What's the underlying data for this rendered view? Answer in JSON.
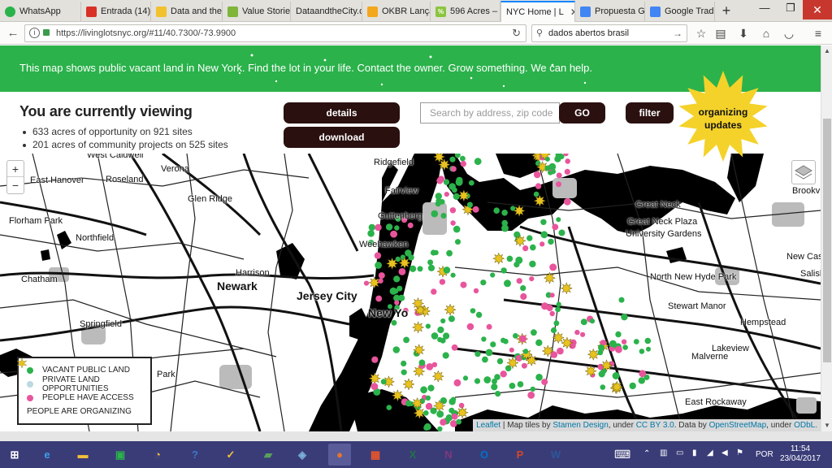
{
  "browser": {
    "tabs": [
      {
        "label": "WhatsApp",
        "color": "#2ab34b"
      },
      {
        "label": "Entrada (14)",
        "color": "#d93025"
      },
      {
        "label": "Data and the",
        "color": "#f2c12e"
      },
      {
        "label": "Value Stories",
        "color": "#7fb539"
      },
      {
        "label": "DataandtheCity.c",
        "color": "#cfcfcf"
      },
      {
        "label": "OKBR Lançar",
        "color": "#f2a71c"
      },
      {
        "label": "596 Acres –",
        "color": "#8bc53f"
      },
      {
        "label": "NYC Home | L",
        "color": "#2bb24b",
        "active": true
      },
      {
        "label": "Propuesta G",
        "color": "#4285f4"
      },
      {
        "label": "Google Trad",
        "color": "#4285f4"
      }
    ],
    "url": "https://livinglotsnyc.org/#11/40.7300/-73.9900",
    "search_value": "dados abertos brasil",
    "window_controls": {
      "minimize": "—",
      "restore": "❐",
      "close": "✕"
    }
  },
  "banner": {
    "text": "This map shows public vacant land in New York. Find the lot in your life. Contact the owner. Grow something. We can help."
  },
  "header": {
    "title": "You are currently viewing",
    "stats": [
      "633 acres of opportunity on 921 sites",
      "201 acres of community projects on 525 sites"
    ],
    "details_label": "details",
    "download_label": "download",
    "search_placeholder": "Search by address, zip code",
    "go_label": "GO",
    "filter_label": "filter",
    "organizing_line1": "organizing",
    "organizing_line2": "updates"
  },
  "map": {
    "zoom_in": "+",
    "zoom_out": "−",
    "places": [
      {
        "id": "west-caldwell",
        "label": "West Caldwell"
      },
      {
        "id": "verona",
        "label": "Verona"
      },
      {
        "id": "ridgefield",
        "label": "Ridgefield"
      },
      {
        "id": "east-hanover",
        "label": "East Hanover"
      },
      {
        "id": "roseland",
        "label": "Roseland"
      },
      {
        "id": "fairview",
        "label": "Fairview"
      },
      {
        "id": "glen-ridge",
        "label": "Glen Ridge"
      },
      {
        "id": "guttenberg",
        "label": "Guttenberg"
      },
      {
        "id": "great-neck",
        "label": "Great Neck"
      },
      {
        "id": "brookville",
        "label": "Brookvi"
      },
      {
        "id": "florham-park",
        "label": "Florham Park"
      },
      {
        "id": "great-neck-plaza",
        "label": "Great Neck Plaza"
      },
      {
        "id": "university-gardens",
        "label": "University Gardens"
      },
      {
        "id": "northfield",
        "label": "Northfield"
      },
      {
        "id": "weehawken",
        "label": "Weehawken"
      },
      {
        "id": "new-cas",
        "label": "New Cas"
      },
      {
        "id": "harrison",
        "label": "Harrison"
      },
      {
        "id": "salisb",
        "label": "Salisb"
      },
      {
        "id": "chatham",
        "label": "Chatham"
      },
      {
        "id": "north-new-hyde-park",
        "label": "North New Hyde Park"
      },
      {
        "id": "stewart-manor",
        "label": "Stewart Manor"
      },
      {
        "id": "springfield",
        "label": "Springfield"
      },
      {
        "id": "hempstead",
        "label": "Hempstead"
      },
      {
        "id": "lakeview",
        "label": "Lakeview"
      },
      {
        "id": "malverne",
        "label": "Malverne"
      },
      {
        "id": "park",
        "label": "Park"
      },
      {
        "id": "east-rockaway",
        "label": "East Rockaway"
      }
    ],
    "major_places": [
      {
        "id": "newark",
        "label": "Newark"
      },
      {
        "id": "jersey-city",
        "label": "Jersey City"
      },
      {
        "id": "new-york",
        "label": "New Yo"
      }
    ],
    "legend": [
      {
        "label": "VACANT PUBLIC LAND",
        "color": "#2bb24b"
      },
      {
        "label": "PRIVATE LAND OPPORTUNITIES",
        "color": "#bcd8e0"
      },
      {
        "label": "PEOPLE HAVE ACCESS",
        "color": "#e8559c"
      },
      {
        "label": "PEOPLE ARE ORGANIZING",
        "color": "#e8c21e"
      }
    ],
    "attribution": {
      "leaflet": "Leaflet",
      "tiles_by": " | Map tiles by ",
      "stamen": "Stamen Design",
      "under": ", under ",
      "ccby": "CC BY 3.0",
      "data_by": ". Data by ",
      "osm": "OpenStreetMap",
      "under2": ", under ",
      "odbl": "ODbL."
    }
  },
  "taskbar": {
    "apps": [
      {
        "id": "start",
        "glyph": "⊞",
        "color": "#ffffff"
      },
      {
        "id": "ie",
        "glyph": "e",
        "color": "#3aa0e8"
      },
      {
        "id": "explorer",
        "glyph": "▬",
        "color": "#f2c03a"
      },
      {
        "id": "store",
        "glyph": "▣",
        "color": "#2bb24b"
      },
      {
        "id": "clock-app",
        "glyph": "◔",
        "color": "#f2c03a"
      },
      {
        "id": "help",
        "glyph": "?",
        "color": "#3a78c8"
      },
      {
        "id": "tasks",
        "glyph": "✓",
        "color": "#f2c03a"
      },
      {
        "id": "notes",
        "glyph": "▰",
        "color": "#5aa05a"
      },
      {
        "id": "crossroads",
        "glyph": "◈",
        "color": "#7ab0d8"
      },
      {
        "id": "firefox",
        "glyph": "●",
        "color": "#e8752a",
        "active": true
      },
      {
        "id": "apps-grid",
        "glyph": "▦",
        "color": "#e8552a"
      },
      {
        "id": "excel",
        "glyph": "X",
        "color": "#217346"
      },
      {
        "id": "onenote",
        "glyph": "N",
        "color": "#80397b"
      },
      {
        "id": "outlook",
        "glyph": "O",
        "color": "#0072c6"
      },
      {
        "id": "powerpoint",
        "glyph": "P",
        "color": "#d24726"
      },
      {
        "id": "word",
        "glyph": "W",
        "color": "#2b579a"
      }
    ],
    "language": "POR",
    "time": "11:54",
    "date": "23/04/2017"
  }
}
